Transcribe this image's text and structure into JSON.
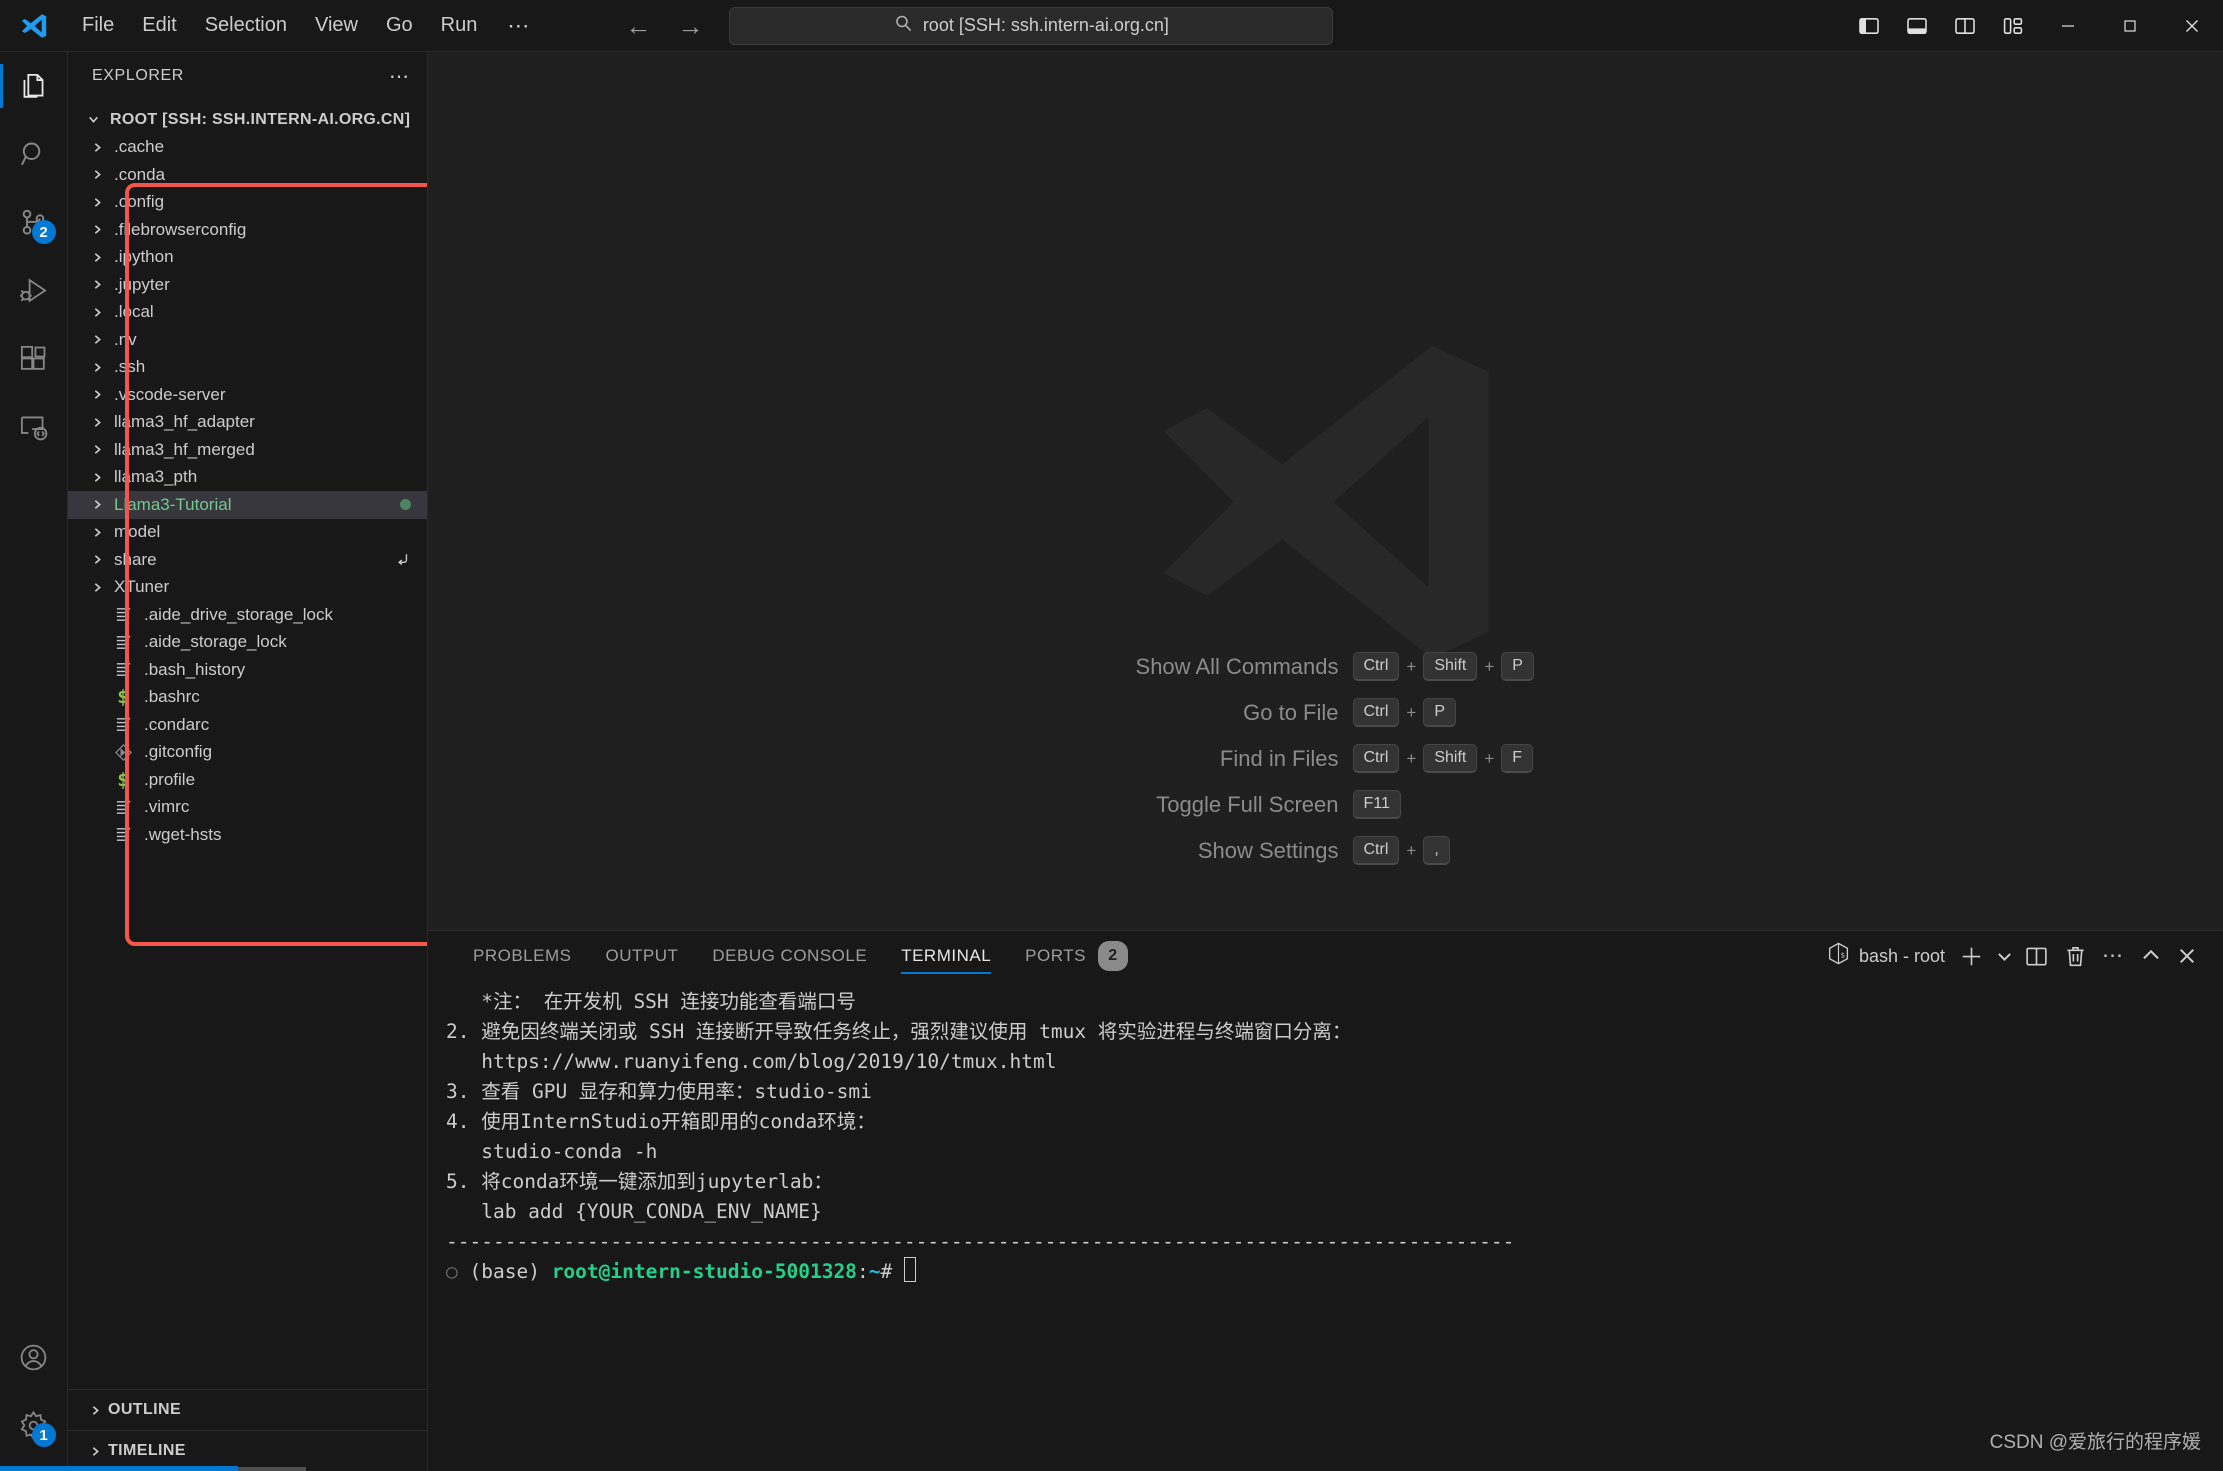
{
  "titlebar": {
    "logo_icon": "vscode-logo-icon",
    "menu": [
      "File",
      "Edit",
      "Selection",
      "View",
      "Go",
      "Run"
    ],
    "menu_overflow": "⋯",
    "nav_back_icon": "arrow-left-icon",
    "nav_forward_icon": "arrow-right-icon",
    "command_center": {
      "search_icon": "search-icon",
      "text": "root [SSH: ssh.intern-ai.org.cn]"
    },
    "layout_buttons": [
      {
        "name": "toggle-primary-sidebar",
        "icon": "layout-sidebar-left-icon"
      },
      {
        "name": "toggle-panel",
        "icon": "layout-panel-icon"
      },
      {
        "name": "toggle-secondary-sidebar",
        "icon": "layout-sidebar-right-icon"
      },
      {
        "name": "customize-layout",
        "icon": "layout-customize-icon"
      }
    ],
    "window_controls": [
      {
        "name": "minimize",
        "glyph": "—"
      },
      {
        "name": "maximize",
        "glyph": "□"
      },
      {
        "name": "close",
        "glyph": "✕"
      }
    ]
  },
  "activitybar": {
    "items": [
      {
        "name": "explorer",
        "icon": "files-icon",
        "active": true,
        "badge": ""
      },
      {
        "name": "search",
        "icon": "search-icon",
        "active": false,
        "badge": ""
      },
      {
        "name": "source-control",
        "icon": "source-control-icon",
        "active": false,
        "badge": "2"
      },
      {
        "name": "run-and-debug",
        "icon": "debug-icon",
        "active": false,
        "badge": ""
      },
      {
        "name": "extensions",
        "icon": "extensions-icon",
        "active": false,
        "badge": ""
      },
      {
        "name": "remote-explorer",
        "icon": "remote-explorer-icon",
        "active": false,
        "badge": ""
      }
    ],
    "bottom": [
      {
        "name": "accounts",
        "icon": "account-icon",
        "badge": ""
      },
      {
        "name": "manage-settings",
        "icon": "gear-icon",
        "badge": "1"
      }
    ]
  },
  "sidebar": {
    "title": "EXPLORER",
    "more_actions": "⋯",
    "root": {
      "label": "ROOT [SSH: SSH.INTERN-AI.ORG.CN]",
      "expanded": true
    },
    "tree": [
      {
        "label": ".cache",
        "type": "folder"
      },
      {
        "label": ".conda",
        "type": "folder"
      },
      {
        "label": ".config",
        "type": "folder"
      },
      {
        "label": ".filebrowserconfig",
        "type": "folder"
      },
      {
        "label": ".ipython",
        "type": "folder"
      },
      {
        "label": ".jupyter",
        "type": "folder"
      },
      {
        "label": ".local",
        "type": "folder"
      },
      {
        "label": ".nv",
        "type": "folder"
      },
      {
        "label": ".ssh",
        "type": "folder"
      },
      {
        "label": ".vscode-server",
        "type": "folder"
      },
      {
        "label": "llama3_hf_adapter",
        "type": "folder"
      },
      {
        "label": "llama3_hf_merged",
        "type": "folder"
      },
      {
        "label": "llama3_pth",
        "type": "folder"
      },
      {
        "label": "Llama3-Tutorial",
        "type": "folder",
        "selected": true,
        "marker": "dot"
      },
      {
        "label": "model",
        "type": "folder"
      },
      {
        "label": "share",
        "type": "folder",
        "marker": "symlink"
      },
      {
        "label": "XTuner",
        "type": "folder"
      },
      {
        "label": ".aide_drive_storage_lock",
        "type": "file",
        "icon": "text-file-icon"
      },
      {
        "label": ".aide_storage_lock",
        "type": "file",
        "icon": "text-file-icon"
      },
      {
        "label": ".bash_history",
        "type": "file",
        "icon": "text-file-icon"
      },
      {
        "label": ".bashrc",
        "type": "file",
        "icon": "shell-file-icon"
      },
      {
        "label": ".condarc",
        "type": "file",
        "icon": "text-file-icon"
      },
      {
        "label": ".gitconfig",
        "type": "file",
        "icon": "git-file-icon"
      },
      {
        "label": ".profile",
        "type": "file",
        "icon": "shell-file-icon"
      },
      {
        "label": ".vimrc",
        "type": "file",
        "icon": "text-file-icon"
      },
      {
        "label": ".wget-hsts",
        "type": "file",
        "icon": "text-file-icon"
      }
    ],
    "sections": [
      {
        "label": "OUTLINE",
        "expanded": false
      },
      {
        "label": "TIMELINE",
        "expanded": false
      }
    ],
    "highlight_color": "#f3564a"
  },
  "editor": {
    "watermark_icon": "vscode-logo-watermark",
    "shortcuts": [
      {
        "label": "Show All Commands",
        "keys": [
          "Ctrl",
          "Shift",
          "P"
        ]
      },
      {
        "label": "Go to File",
        "keys": [
          "Ctrl",
          "P"
        ]
      },
      {
        "label": "Find in Files",
        "keys": [
          "Ctrl",
          "Shift",
          "F"
        ]
      },
      {
        "label": "Toggle Full Screen",
        "keys": [
          "F11"
        ]
      },
      {
        "label": "Show Settings",
        "keys": [
          "Ctrl",
          ","
        ]
      }
    ]
  },
  "panel": {
    "tabs": [
      {
        "label": "PROBLEMS",
        "active": false,
        "badge": ""
      },
      {
        "label": "OUTPUT",
        "active": false,
        "badge": ""
      },
      {
        "label": "DEBUG CONSOLE",
        "active": false,
        "badge": ""
      },
      {
        "label": "TERMINAL",
        "active": true,
        "badge": ""
      },
      {
        "label": "PORTS",
        "active": false,
        "badge": "2"
      }
    ],
    "actions": {
      "shell_icon": "bash-terminal-icon",
      "shell_label": "bash - root",
      "new_terminal_icon": "plus-icon",
      "new_terminal_dropdown_icon": "chevron-down-icon",
      "split_icon": "split-editor-icon",
      "kill_icon": "trash-icon",
      "more_icon": "ellipsis-icon",
      "maximize_icon": "chevron-up-icon",
      "close_icon": "close-icon"
    },
    "terminal_lines": [
      {
        "text": "   *注： 在开发机 SSH 连接功能查看端口号"
      },
      {
        "text": ""
      },
      {
        "text": "2. 避免因终端关闭或 SSH 连接断开导致任务终止，强烈建议使用 tmux 将实验进程与终端窗口分离："
      },
      {
        "text": "   https://www.ruanyifeng.com/blog/2019/10/tmux.html"
      },
      {
        "text": ""
      },
      {
        "text": "3. 查看 GPU 显存和算力使用率：studio-smi"
      },
      {
        "text": ""
      },
      {
        "text": "4. 使用InternStudio开箱即用的conda环境："
      },
      {
        "text": "   studio-conda -h"
      },
      {
        "text": ""
      },
      {
        "text": "5. 将conda环境一键添加到jupyterlab："
      },
      {
        "text": "   lab add {YOUR_CONDA_ENV_NAME}"
      },
      {
        "text": ""
      },
      {
        "text": ""
      },
      {
        "text": "-------------------------------------------------------------------------------------------"
      },
      {
        "text": ""
      }
    ],
    "prompt": {
      "status_glyph": "○",
      "env": "(base) ",
      "user_host": "root@intern-studio-5001328",
      "colon": ":",
      "path": "~",
      "sigil": "# ",
      "cursor": true
    }
  },
  "watermark": "CSDN @爱旅行的程序媛",
  "colors": {
    "accent": "#0078d4",
    "highlight_box": "#f3564a",
    "terminal_green": "#23d18b",
    "selected_folder_text": "#73c991"
  }
}
